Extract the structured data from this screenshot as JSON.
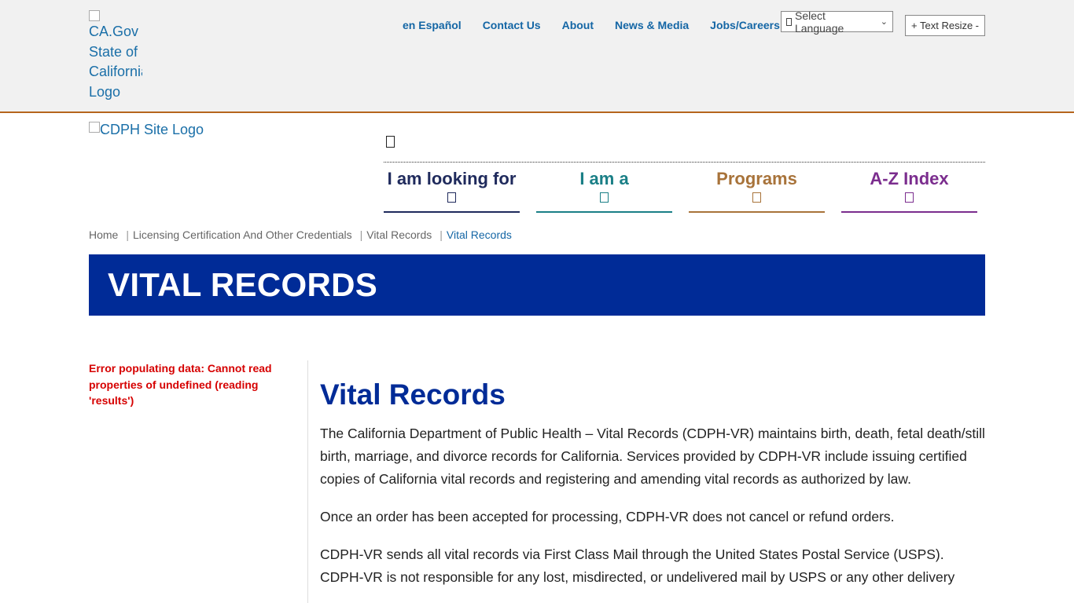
{
  "utility": {
    "ca_logo_alt": "CA.Gov State of California Logo",
    "links": [
      "en Español",
      "Contact Us",
      "About",
      "News & Media",
      "Jobs/Careers"
    ],
    "language_select": "Select Language",
    "text_resize": {
      "plus": "+",
      "label": "Text Resize",
      "minus": "-"
    }
  },
  "site_logo_alt": "CDPH Site Logo",
  "nav": {
    "items": [
      {
        "label": "I am looking for",
        "color": "#1f2a5c"
      },
      {
        "label": "I am a",
        "color": "#1a7f86"
      },
      {
        "label": "Programs",
        "color": "#a8733a"
      },
      {
        "label": "A-Z Index",
        "color": "#7b2d8e"
      }
    ]
  },
  "breadcrumb": [
    "Home",
    "Licensing Certification And Other Credentials",
    "Vital Records",
    "Vital Records"
  ],
  "banner_title": "VITAL RECORDS",
  "sidebar_error": "Error populating data: Cannot read properties of undefined (reading 'results')",
  "main": {
    "heading": "Vital Records",
    "paragraphs": [
      "The California Department of Public Health – Vital Records (CDPH-VR) maintains birth, death, fetal death/still birth, marriage, and divorce records for California. Services provided by CDPH-VR include issuing certified copies of California vital records and registering and amending vital records as authorized by law.",
      "Once an order has been accepted for processing, CDPH-VR does not cancel or refund orders.",
      "CDPH-VR sends all vital records via First Class Mail through the United States Postal Service (USPS). CDPH-VR is not responsible for any lost, misdirected, or undelivered mail by USPS or any other delivery"
    ]
  },
  "colors": {
    "banner": "#002b97",
    "link": "#1466a5",
    "header_border": "#b5651d",
    "error": "#d60000"
  }
}
